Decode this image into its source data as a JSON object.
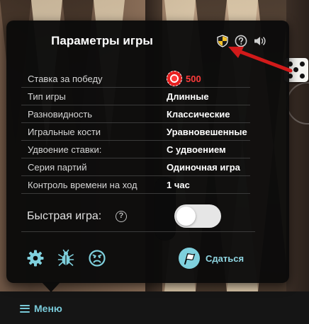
{
  "dialog": {
    "title": "Параметры игры",
    "header_icons": [
      "shield-icon",
      "help-icon",
      "sound-icon"
    ],
    "rows": [
      {
        "label": "Ставка за победу",
        "value": "500",
        "icon": "chip-icon"
      },
      {
        "label": "Тип игры",
        "value": "Длинные"
      },
      {
        "label": "Разновидность",
        "value": "Классические"
      },
      {
        "label": "Игральные кости",
        "value": "Уравновешенные"
      },
      {
        "label": "Удвоение ставки:",
        "value": "С удвоением"
      },
      {
        "label": "Серия партий",
        "value": "Одиночная игра"
      },
      {
        "label": "Контроль времени на ход",
        "value": "1 час"
      }
    ],
    "quick_game": {
      "label": "Быстрая игра:",
      "enabled": false
    },
    "bottom_icons": [
      "gear-icon",
      "bug-icon",
      "sad-face-icon"
    ],
    "surrender_label": "Сдаться"
  },
  "menu": {
    "label": "Меню"
  },
  "colors": {
    "accent": "#79c9d8",
    "stake": "#ff3b3b",
    "dialog_bg": "#0a0a0a",
    "annotation_arrow": "#d11a1a"
  }
}
